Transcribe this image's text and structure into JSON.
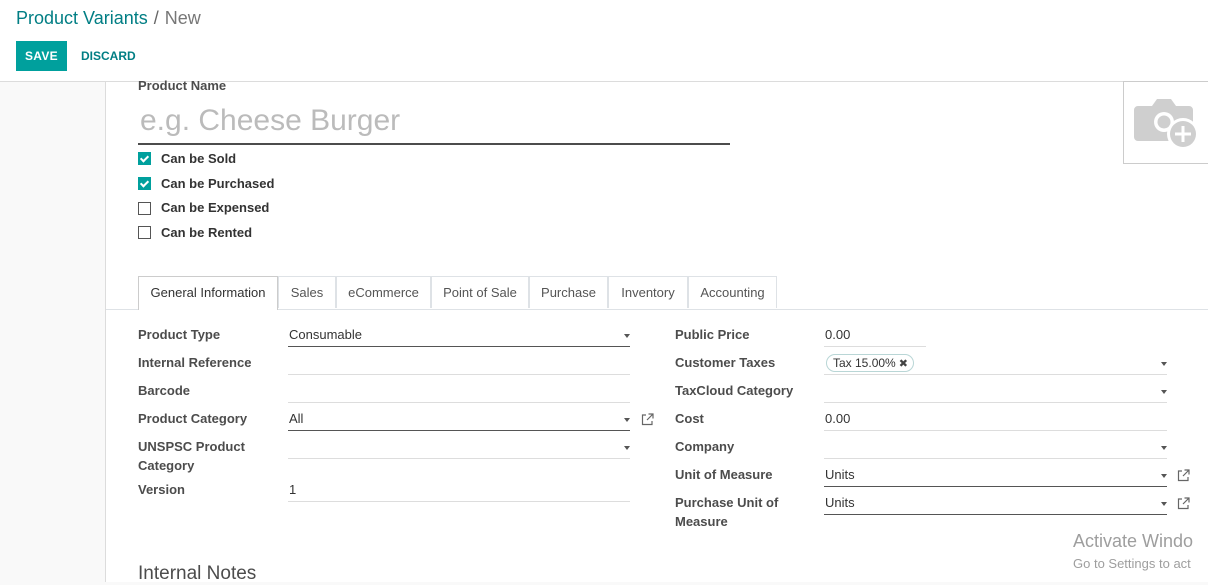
{
  "breadcrumb": {
    "parent": "Product Variants",
    "separator": "/",
    "current": "New"
  },
  "toolbar": {
    "save_label": "SAVE",
    "discard_label": "DISCARD"
  },
  "form": {
    "product_name_label": "Product Name",
    "product_name_placeholder": "e.g. Cheese Burger",
    "checkboxes": [
      {
        "label": "Can be Sold",
        "checked": true
      },
      {
        "label": "Can be Purchased",
        "checked": true
      },
      {
        "label": "Can be Expensed",
        "checked": false
      },
      {
        "label": "Can be Rented",
        "checked": false
      }
    ],
    "photo_icon": "camera-plus-icon"
  },
  "tabs": [
    "General Information",
    "Sales",
    "eCommerce",
    "Point of Sale",
    "Purchase",
    "Inventory",
    "Accounting"
  ],
  "active_tab": "General Information",
  "left_fields": {
    "product_type": {
      "label": "Product Type",
      "value": "Consumable"
    },
    "internal_reference": {
      "label": "Internal Reference",
      "value": ""
    },
    "barcode": {
      "label": "Barcode",
      "value": ""
    },
    "product_category": {
      "label": "Product Category",
      "value": "All"
    },
    "unspsc": {
      "label_line1": "UNSPSC Product",
      "label_line2": "Category",
      "value": ""
    },
    "version": {
      "label": "Version",
      "value": "1"
    }
  },
  "right_fields": {
    "public_price": {
      "label": "Public Price",
      "value": "0.00"
    },
    "customer_taxes": {
      "label": "Customer Taxes",
      "tag": "Tax 15.00%",
      "tag_remove": "✖"
    },
    "taxcloud_category": {
      "label": "TaxCloud Category",
      "value": ""
    },
    "cost": {
      "label": "Cost",
      "value": "0.00"
    },
    "company": {
      "label": "Company",
      "value": ""
    },
    "unit_of_measure": {
      "label": "Unit of Measure",
      "value": "Units"
    },
    "purchase_uom": {
      "label_line1": "Purchase Unit of",
      "label_line2": "Measure",
      "value": "Units"
    }
  },
  "internal_notes_label": "Internal Notes",
  "watermark": {
    "line1": "Activate Windo",
    "line2": "Go to Settings to act"
  },
  "colors": {
    "accent": "#00a09d",
    "link": "#017e84"
  }
}
